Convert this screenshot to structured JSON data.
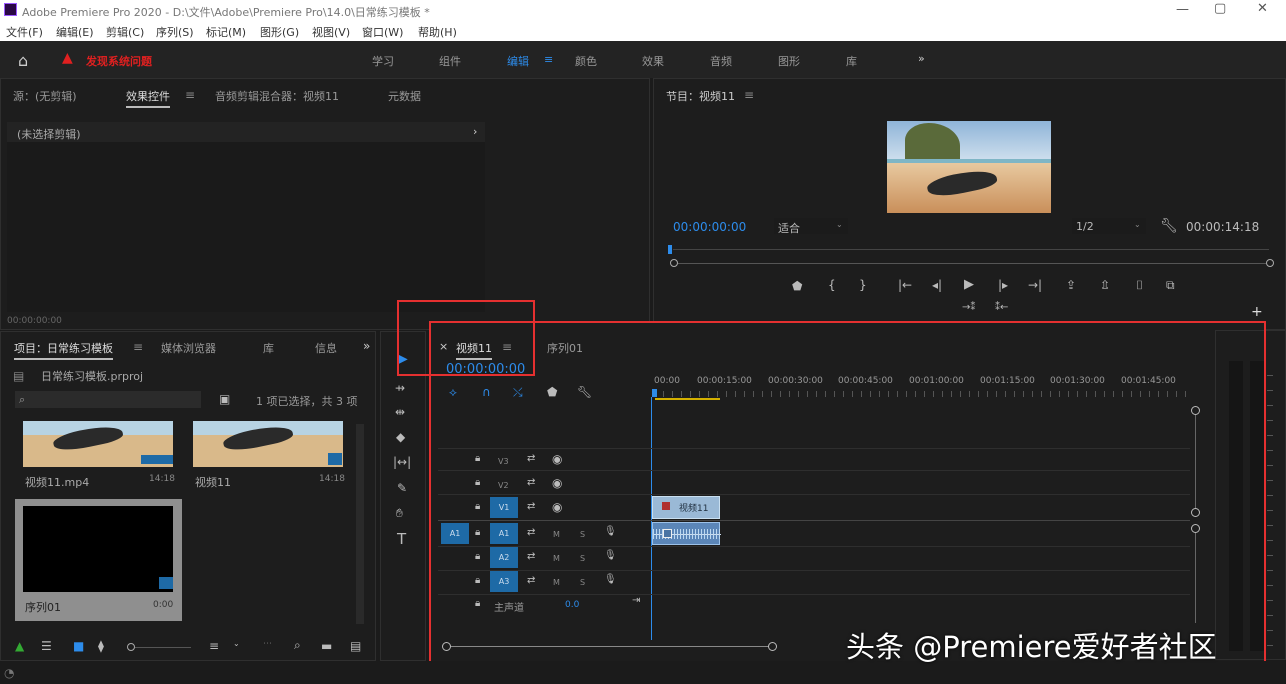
{
  "title": "Adobe Premiere Pro 2020 - D:\\文件\\Adobe\\Premiere Pro\\14.0\\日常练习模板 *",
  "menu": [
    "文件(F)",
    "编辑(E)",
    "剪辑(C)",
    "序列(S)",
    "标记(M)",
    "图形(G)",
    "视图(V)",
    "窗口(W)",
    "帮助(H)"
  ],
  "workspace": {
    "alert": "发现系统问题",
    "tabs": [
      "学习",
      "组件",
      "编辑",
      "颜色",
      "效果",
      "音频",
      "图形",
      "库"
    ],
    "more": "»"
  },
  "source_panel": {
    "tabs": [
      "源：(无剪辑)",
      "效果控件",
      "音频剪辑混合器：视频11",
      "元数据"
    ],
    "no_clip": "(未选择剪辑)",
    "timecode": "00:00:00:00"
  },
  "program": {
    "title": "节目：视频11",
    "timecode": "00:00:00:00",
    "fit": "适合",
    "ratio": "1/2",
    "duration": "00:00:14:18"
  },
  "project": {
    "tabs": [
      "项目：日常练习模板",
      "媒体浏览器",
      "库",
      "信息"
    ],
    "file": "日常练习模板.prproj",
    "selection": "1 项已选择，共 3 项",
    "items": [
      {
        "name": "视频11.mp4",
        "dur": "14:18"
      },
      {
        "name": "视频11",
        "dur": "14:18"
      },
      {
        "name": "序列01",
        "dur": "0:00"
      }
    ]
  },
  "timeline": {
    "tabs": [
      "视频11",
      "序列01"
    ],
    "timecode": "00:00:00:00",
    "ruler": [
      "00:00",
      "00:00:15:00",
      "00:00:30:00",
      "00:00:45:00",
      "00:01:00:00",
      "00:01:15:00",
      "00:01:30:00",
      "00:01:45:00"
    ],
    "video_tracks": [
      "V3",
      "V2",
      "V1"
    ],
    "audio_tracks": [
      "A1",
      "A2",
      "A3"
    ],
    "source_audio": "A1",
    "master": "主声道",
    "master_val": "0.0",
    "clip": "视频11",
    "mute": "M",
    "solo": "S"
  },
  "watermark": "头条 @Premiere爱好者社区"
}
